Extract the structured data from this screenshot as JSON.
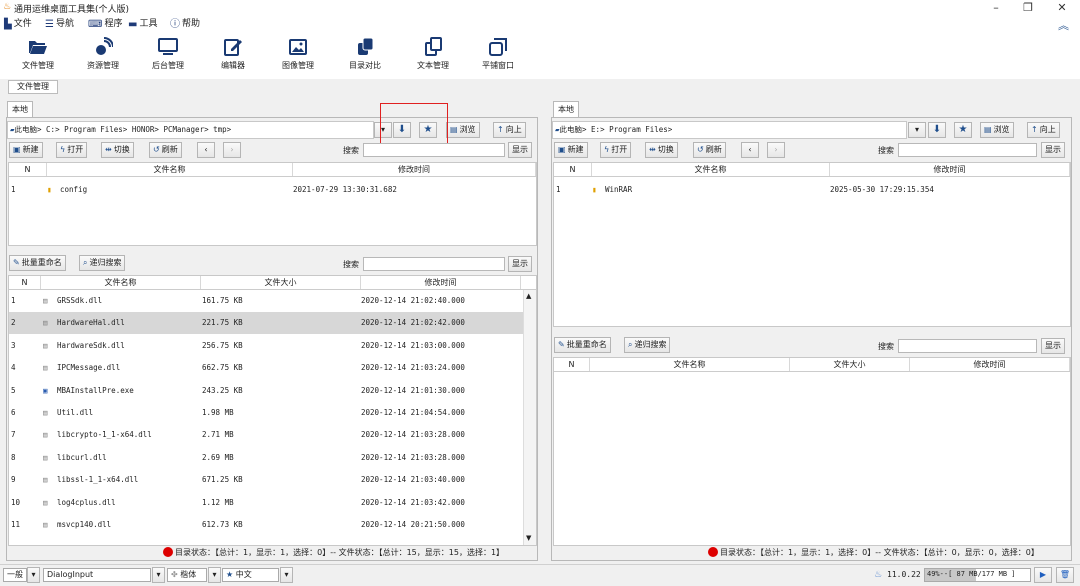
{
  "window": {
    "title": "通用运维桌面工具集(个人版)",
    "minimize": "–",
    "maximize": "❐",
    "close": "✕",
    "collapse": "︽"
  },
  "menu": [
    {
      "label": "文件",
      "icon": "file-icon"
    },
    {
      "label": "导航",
      "icon": "list-icon"
    },
    {
      "label": "程序",
      "icon": "keyboard-icon"
    },
    {
      "label": "工具",
      "icon": "toolbox-icon"
    },
    {
      "label": "帮助",
      "icon": "help-icon"
    }
  ],
  "toolbar": [
    {
      "label": "文件管理",
      "icon": "folder-open-icon"
    },
    {
      "label": "资源管理",
      "icon": "satellite-icon"
    },
    {
      "label": "后台管理",
      "icon": "monitor-icon"
    },
    {
      "label": "编辑器",
      "icon": "edit-icon"
    },
    {
      "label": "图像管理",
      "icon": "image-icon"
    },
    {
      "label": "目录对比",
      "icon": "compare-dir-icon"
    },
    {
      "label": "文本管理",
      "icon": "text-compare-icon"
    },
    {
      "label": "平铺窗口",
      "icon": "tile-window-icon"
    }
  ],
  "module_tab": "文件管理",
  "left": {
    "tab": "本地",
    "path": "此电脑> C:> Program Files> HONOR> PCManager> tmp>",
    "btn_browse": "浏览",
    "btn_up": "向上",
    "btn_new": "新建",
    "btn_open": "打开",
    "btn_switch": "切换",
    "btn_refresh": "刷新",
    "search_label": "搜索",
    "show_label": "显示",
    "dir_cols": [
      "N",
      "文件名称",
      "修改时间"
    ],
    "dirs": [
      {
        "n": "1",
        "name": "config",
        "time": "2021-07-29 13:30:31.682"
      }
    ],
    "btn_rename": "批量重命名",
    "btn_recursive": "递归搜索",
    "file_cols": [
      "N",
      "文件名称",
      "文件大小",
      "修改时间"
    ],
    "files": [
      {
        "n": "1",
        "name": "GRSSdk.dll",
        "size": "161.75 KB",
        "time": "2020-12-14 21:02:40.000"
      },
      {
        "n": "2",
        "name": "HardwareHal.dll",
        "size": "221.75 KB",
        "time": "2020-12-14 21:02:42.000"
      },
      {
        "n": "3",
        "name": "HardwareSdk.dll",
        "size": "256.75 KB",
        "time": "2020-12-14 21:03:00.000"
      },
      {
        "n": "4",
        "name": "IPCMessage.dll",
        "size": "662.75 KB",
        "time": "2020-12-14 21:03:24.000"
      },
      {
        "n": "5",
        "name": "MBAInstallPre.exe",
        "size": "243.25 KB",
        "time": "2020-12-14 21:01:30.000"
      },
      {
        "n": "6",
        "name": "Util.dll",
        "size": "1.98 MB",
        "time": "2020-12-14 21:04:54.000"
      },
      {
        "n": "7",
        "name": "libcrypto-1_1-x64.dll",
        "size": "2.71 MB",
        "time": "2020-12-14 21:03:28.000"
      },
      {
        "n": "8",
        "name": "libcurl.dll",
        "size": "2.69 MB",
        "time": "2020-12-14 21:03:28.000"
      },
      {
        "n": "9",
        "name": "libssl-1_1-x64.dll",
        "size": "671.25 KB",
        "time": "2020-12-14 21:03:40.000"
      },
      {
        "n": "10",
        "name": "log4cplus.dll",
        "size": "1.12 MB",
        "time": "2020-12-14 21:03:42.000"
      },
      {
        "n": "11",
        "name": "msvcp140.dll",
        "size": "612.73 KB",
        "time": "2020-12-14 20:21:50.000"
      }
    ],
    "status": "目录状态：【总计：1，显示：1，选择：0】-- 文件状态：【总计：15，显示：15，选择：1】"
  },
  "right": {
    "tab": "本地",
    "path": "此电脑> E:> Program Files>",
    "btn_browse": "浏览",
    "btn_up": "向上",
    "btn_new": "新建",
    "btn_open": "打开",
    "btn_switch": "切换",
    "btn_refresh": "刷新",
    "search_label": "搜索",
    "show_label": "显示",
    "dir_cols": [
      "N",
      "文件名称",
      "修改时间"
    ],
    "dirs": [
      {
        "n": "1",
        "name": "WinRAR",
        "time": "2025-05-30 17:29:15.354"
      }
    ],
    "btn_rename": "批量重命名",
    "btn_recursive": "递归搜索",
    "file_cols": [
      "N",
      "文件名称",
      "文件大小",
      "修改时间"
    ],
    "status": "目录状态：【总计：1，显示：1，选择：0】-- 文件状态：【总计：0，显示：0，选择：0】"
  },
  "bottom": {
    "mode": "一般",
    "input": "DialogInput",
    "font": "楷体",
    "lang": "中文",
    "version": "11.0.22",
    "memory": "49%--[ 87 MB/177 MB ]",
    "memory_fraction": 0.49
  }
}
